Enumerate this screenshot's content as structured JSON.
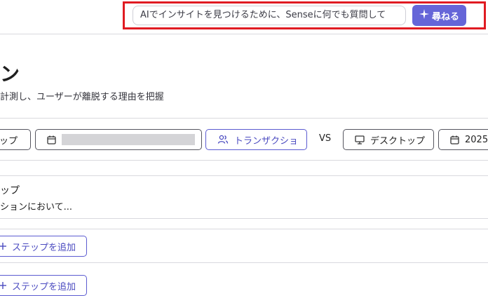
{
  "header": {
    "ask_placeholder": "AIでインサイトを見つけるために、Senseに何でも質問して",
    "ask_button_label": "尋ねる"
  },
  "page": {
    "title_fragment": "ン",
    "subtitle": "計測し、ユーザーが離脱する理由を把握"
  },
  "filters": {
    "left_pill_label": "ップ",
    "segment_label": "トランザクショ",
    "vs_label": "VS",
    "device_label": "デスクトップ",
    "date_label": "2025/"
  },
  "step": {
    "title": "ップ",
    "description": "ションにおいて..."
  },
  "actions": {
    "add_step_label": "ステップを追加",
    "add_step_label_2": "ステップを追加"
  }
}
